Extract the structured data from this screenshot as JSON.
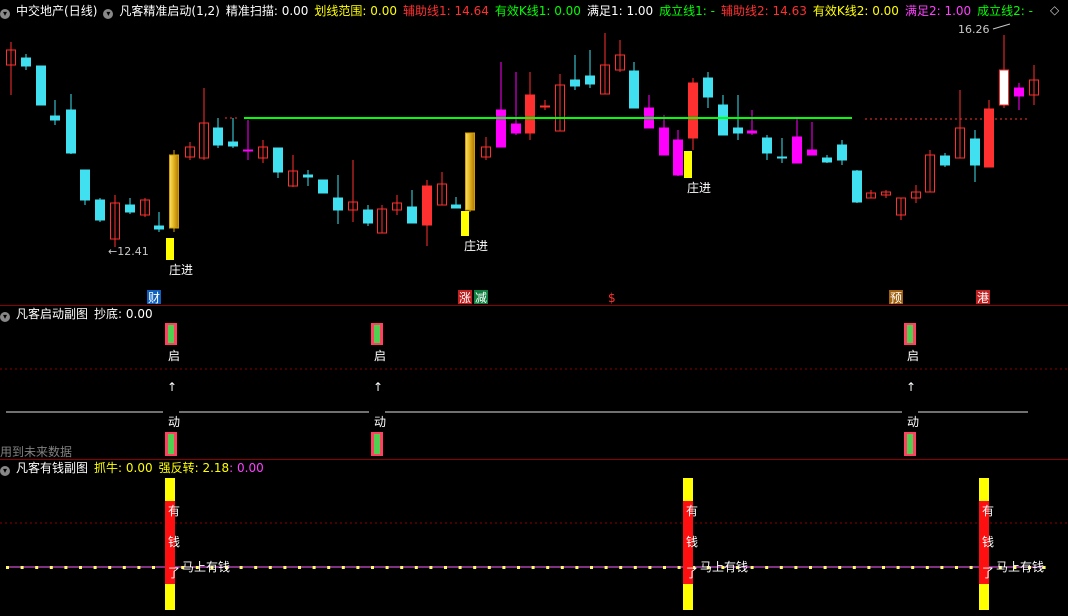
{
  "main": {
    "stock": "中交地产",
    "period": "(日线)",
    "indicator": "凡客精准启动(1,2)",
    "values": [
      {
        "label": "精准扫描: 0.00",
        "color": "#ffffff"
      },
      {
        "label": "划线范围: 0.00",
        "color": "#ffff00"
      },
      {
        "label": "辅助线1: 14.64",
        "color": "#ff3030"
      },
      {
        "label": "有效K线1: 0.00",
        "color": "#00ff00"
      },
      {
        "label": "满足1: 1.00",
        "color": "#ffffff"
      },
      {
        "label": "成立线1: -",
        "color": "#00ff00"
      },
      {
        "label": "辅助线2: 14.63",
        "color": "#ff3030"
      },
      {
        "label": "有效K线2: 0.00",
        "color": "#ffff00"
      },
      {
        "label": "满足2: 1.00",
        "color": "#ff40ff"
      },
      {
        "label": "成立线2: -",
        "color": "#00ff00"
      }
    ],
    "high_label": "16.26",
    "low_label": "12.41",
    "entry_label": "庄进",
    "markers": [
      {
        "text": "财",
        "bg": "#1060c0",
        "color": "#ffffff"
      },
      {
        "text": "涨",
        "bg": "#c02020",
        "color": "#ffffff"
      },
      {
        "text": "减",
        "bg": "#108040",
        "color": "#ffffff"
      },
      {
        "text": "$",
        "bg": "",
        "color": "#ff3030"
      },
      {
        "text": "预",
        "bg": "#a06010",
        "color": "#ffffff"
      },
      {
        "text": "港",
        "bg": "#c02020",
        "color": "#ffffff"
      }
    ]
  },
  "sub1": {
    "indicator": "凡客启动副图",
    "value": "抄底: 0.00",
    "label_top": "启",
    "label_arrow": "↑",
    "label_bottom": "动",
    "footer": "用到未来数据"
  },
  "sub2": {
    "indicator": "凡客有钱副图",
    "value1": "抓牛: 0.00",
    "value2": "强反转: 2.18",
    "value3": ": 0.00",
    "chars": [
      "有",
      "钱",
      "了"
    ],
    "tag": "马上有钱"
  },
  "corner": {
    "left": "◁",
    "right": "◇"
  },
  "colors": {
    "up": "#ff3030",
    "down": "#40e0f0",
    "green_line": "#00ff00",
    "yellow": "#ffff00",
    "magenta": "#ff00ff"
  }
}
